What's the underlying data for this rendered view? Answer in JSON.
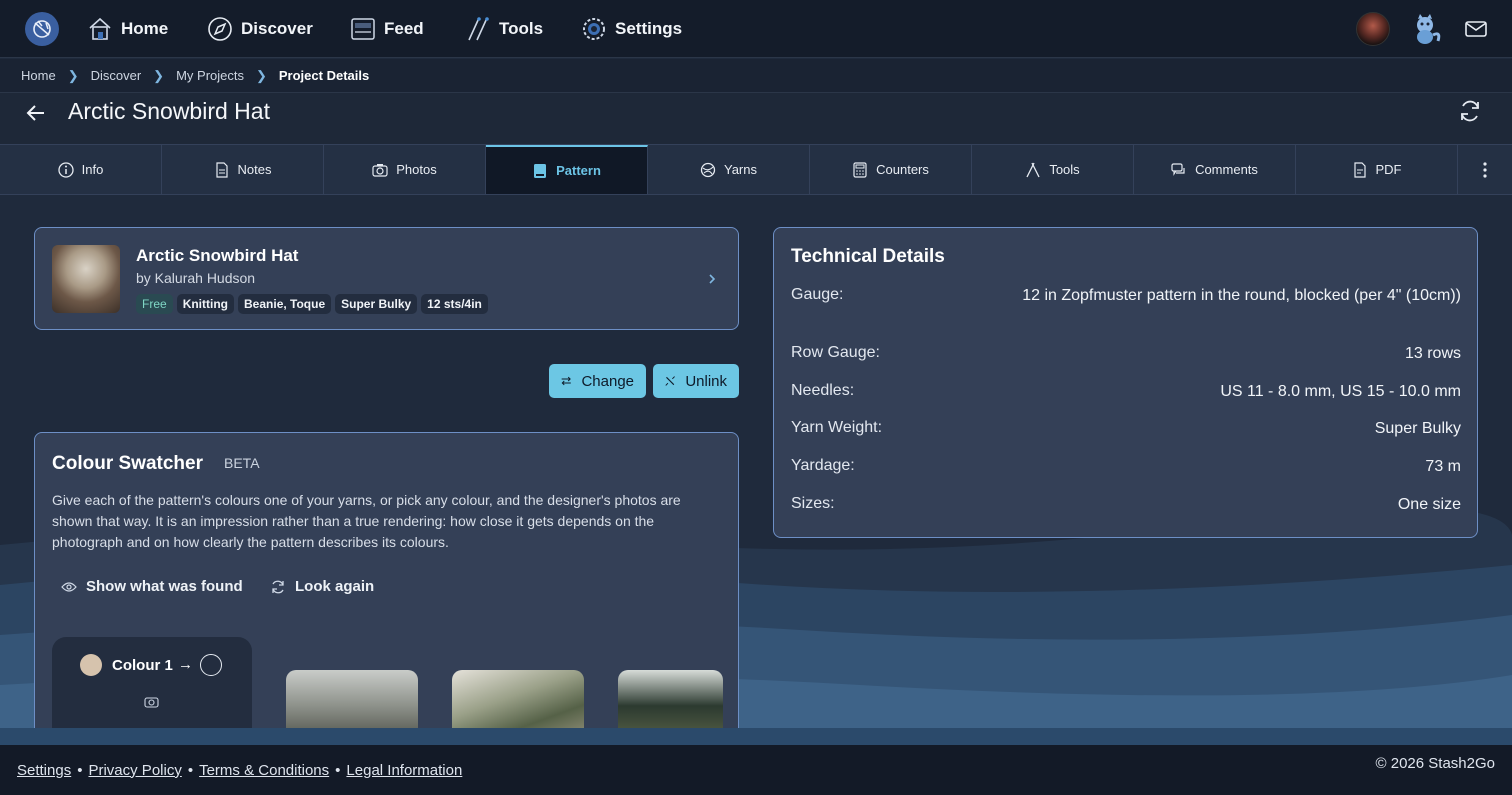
{
  "nav": {
    "items": [
      {
        "label": "Home",
        "icon": "home-icon"
      },
      {
        "label": "Discover",
        "icon": "compass-icon"
      },
      {
        "label": "Feed",
        "icon": "feed-icon"
      },
      {
        "label": "Tools",
        "icon": "needles-icon"
      },
      {
        "label": "Settings",
        "icon": "gear-icon"
      }
    ],
    "right_icons": [
      "user-avatar",
      "mascot-icon",
      "mail-icon"
    ]
  },
  "breadcrumb": [
    "Home",
    "Discover",
    "My Projects",
    "Project Details"
  ],
  "page": {
    "title": "Arctic Snowbird Hat"
  },
  "tabs": [
    {
      "label": "Info",
      "icon": "info-icon"
    },
    {
      "label": "Notes",
      "icon": "notes-icon"
    },
    {
      "label": "Photos",
      "icon": "camera-icon"
    },
    {
      "label": "Pattern",
      "icon": "book-icon",
      "active": true
    },
    {
      "label": "Yarns",
      "icon": "yarn-icon"
    },
    {
      "label": "Counters",
      "icon": "calculator-icon"
    },
    {
      "label": "Tools",
      "icon": "needles-icon"
    },
    {
      "label": "Comments",
      "icon": "comments-icon"
    },
    {
      "label": "PDF",
      "icon": "pdf-icon"
    }
  ],
  "pattern": {
    "name": "Arctic Snowbird Hat",
    "author": "by Kalurah Hudson",
    "tags": [
      "Free",
      "Knitting",
      "Beanie, Toque",
      "Super Bulky",
      "12 sts/4in"
    ]
  },
  "actions": {
    "change": "Change",
    "unlink": "Unlink"
  },
  "swatcher": {
    "title": "Colour Swatcher",
    "badge": "BETA",
    "description": "Give each of the pattern's colours one of your yarns, or pick any colour, and the designer's photos are shown that way. It is an impression rather than a true rendering: how close it gets depends on the photograph and on how clearly the pattern describes its colours.",
    "show_found": "Show what was found",
    "look_again": "Look again",
    "colour_label": "Colour 1",
    "arrow": "→",
    "colour_swatch": "#d6c3ad"
  },
  "technical": {
    "title": "Technical Details",
    "rows": [
      {
        "label": "Gauge:",
        "value": "12 in Zopfmuster pattern in the round, blocked (per 4\" (10cm))"
      },
      {
        "label": "Row Gauge:",
        "value": "13 rows"
      },
      {
        "label": "Needles:",
        "value": "US 11  - 8.0 mm, US 15  - 10.0 mm"
      },
      {
        "label": "Yarn Weight:",
        "value": "Super Bulky"
      },
      {
        "label": "Yardage:",
        "value": "73 m"
      },
      {
        "label": "Sizes:",
        "value": "One size"
      }
    ]
  },
  "footer": {
    "links": [
      "Settings",
      "Privacy Policy",
      "Terms & Conditions",
      "Legal Information"
    ],
    "copyright": "© 2026 Stash2Go"
  },
  "colors": {
    "accent": "#6cc7e4",
    "card_border": "#6d8fc6"
  }
}
